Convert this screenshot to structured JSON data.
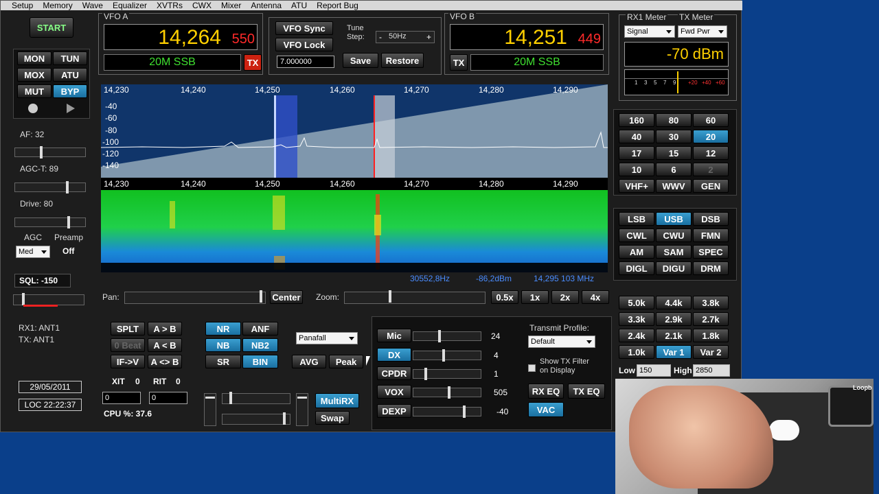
{
  "menu": [
    "Setup",
    "Memory",
    "Wave",
    "Equalizer",
    "XVTRs",
    "CWX",
    "Mixer",
    "Antenna",
    "ATU",
    "Report Bug"
  ],
  "start": "START",
  "left_buttons": [
    [
      "MON",
      "TUN"
    ],
    [
      "MOX",
      "ATU"
    ],
    [
      "MUT",
      "BYP"
    ]
  ],
  "af": "AF: 32",
  "agct": "AGC-T: 89",
  "drive": "Drive: 80",
  "agc_label": "AGC",
  "agc_value": "Med",
  "preamp_label": "Preamp",
  "preamp_value": "Off",
  "sql": "SQL: -150",
  "rx1_ant": "RX1: ANT1",
  "tx_ant": "TX: ANT1",
  "date": "29/05/2011",
  "loc": "LOC 22:22:37",
  "vfoa": {
    "title": "VFO A",
    "freq": "14,264",
    "sub": "550",
    "mode": "20M SSB",
    "tx": "TX"
  },
  "vfob": {
    "title": "VFO B",
    "freq": "14,251",
    "sub": "449",
    "mode": "20M SSB",
    "tx": "TX"
  },
  "vfo_sync": "VFO Sync",
  "vfo_lock": "VFO Lock",
  "vfo_entry": "7.000000",
  "tune_step_label": "Tune Step:",
  "tune_step": "50Hz",
  "minus": "-",
  "plus": "+",
  "save": "Save",
  "restore": "Restore",
  "rx1_meter": "RX1 Meter",
  "tx_meter": "TX Meter",
  "signal": "Signal",
  "fwd_pwr": "Fwd Pwr",
  "meter_value": "-70 dBm",
  "meter_scale": [
    "1",
    "3",
    "5",
    "7",
    "9",
    "+20",
    "+40",
    "+60"
  ],
  "freq_axis": [
    "14,230",
    "14,240",
    "14,250",
    "14,260",
    "14,270",
    "14,280",
    "14,290"
  ],
  "db_axis": [
    "-40",
    "-60",
    "-80",
    "-100",
    "-120",
    "-140"
  ],
  "readout": {
    "freq": "30552,8Hz",
    "dbm": "-86,2dBm",
    "mhz": "14,295 103 MHz"
  },
  "pan": "Pan:",
  "center": "Center",
  "zoom": "Zoom:",
  "zoom_levels": [
    "0.5x",
    "1x",
    "2x",
    "4x"
  ],
  "bands": [
    [
      "160",
      "80",
      "60"
    ],
    [
      "40",
      "30",
      "20"
    ],
    [
      "17",
      "15",
      "12"
    ],
    [
      "10",
      "6",
      "2"
    ],
    [
      "VHF+",
      "WWV",
      "GEN"
    ]
  ],
  "modes": [
    [
      "LSB",
      "USB",
      "DSB"
    ],
    [
      "CWL",
      "CWU",
      "FMN"
    ],
    [
      "AM",
      "SAM",
      "SPEC"
    ],
    [
      "DIGL",
      "DIGU",
      "DRM"
    ]
  ],
  "filters": [
    [
      "5.0k",
      "4.4k",
      "3.8k"
    ],
    [
      "3.3k",
      "2.9k",
      "2.7k"
    ],
    [
      "2.4k",
      "2.1k",
      "1.8k"
    ],
    [
      "1.0k",
      "Var 1",
      "Var 2"
    ]
  ],
  "low_label": "Low",
  "low_value": "150",
  "high_label": "High",
  "high_value": "2850",
  "split_buttons": [
    [
      "SPLT",
      "A > B"
    ],
    [
      "0 Beat",
      "A < B"
    ],
    [
      "IF->V",
      "A <> B"
    ]
  ],
  "xit": "XIT",
  "xit_val": "0",
  "rit": "RIT",
  "rit_val": "0",
  "xit_field": "0",
  "rit_field": "0",
  "cpu": "CPU %: 37.6",
  "nr_buttons": [
    [
      "NR",
      "ANF"
    ],
    [
      "NB",
      "NB2"
    ],
    [
      "SR",
      "BIN"
    ]
  ],
  "display_mode": "Panafall",
  "avg": "AVG",
  "peak": "Peak",
  "multirx": "MultiRX",
  "swap": "Swap",
  "tx_rows": [
    {
      "label": "Mic",
      "value": "24"
    },
    {
      "label": "DX",
      "value": "4"
    },
    {
      "label": "CPDR",
      "value": "1"
    },
    {
      "label": "VOX",
      "value": "505"
    },
    {
      "label": "DEXP",
      "value": "-40"
    }
  ],
  "transmit_profile_label": "Transmit Profile:",
  "transmit_profile": "Default",
  "show_tx_filter": "Show TX Filter on Display",
  "rx_eq": "RX EQ",
  "tx_eq": "TX EQ",
  "vac": "VAC",
  "loopback": "Loopb",
  "colors": {
    "accent": "#2a8fc4",
    "vfo_yellow": "#ffd000",
    "vfo_red": "#ff2a2a",
    "mode_green": "#3fe030",
    "desktop": "#0a3f8a"
  }
}
